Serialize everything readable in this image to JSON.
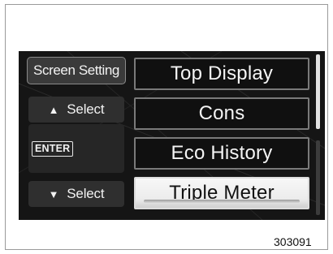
{
  "left_panel": {
    "screen_setting": "Screen Setting",
    "select_up_label": "Select",
    "select_down_label": "Select",
    "enter_label": "ENTER",
    "up_arrow_icon": "triangle-up",
    "down_arrow_icon": "triangle-down"
  },
  "menu": {
    "items": [
      "Top Display",
      "Cons",
      "Eco History",
      "Triple Meter"
    ],
    "selected_index": 3
  },
  "figure_number": "303091",
  "colors": {
    "screen_bg": "#151515",
    "selected_bg": "#f2f2f2",
    "text": "#f4f4f4"
  }
}
